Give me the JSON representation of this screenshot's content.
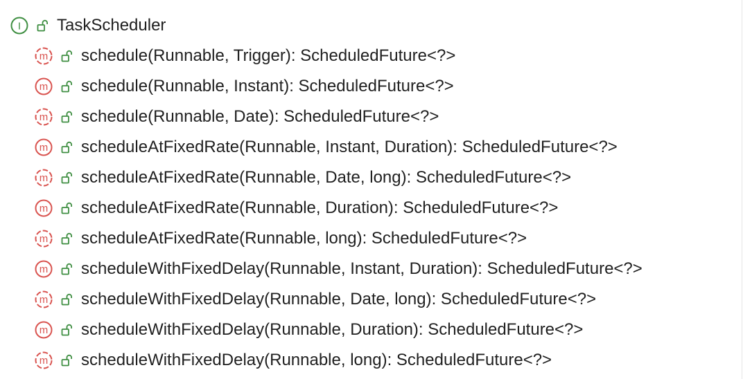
{
  "colors": {
    "interface_badge": "#3e8e41",
    "method_badge": "#d9534f",
    "lock_icon": "#3e8e41",
    "text": "#1f1f1f"
  },
  "root": {
    "icon": "interface-icon",
    "badge_letter": "I",
    "visibility_icon": "unlocked-icon",
    "label": "TaskScheduler"
  },
  "members": [
    {
      "icon": "abstract-method-icon",
      "badge_letter": "m",
      "abstract": true,
      "visibility_icon": "unlocked-icon",
      "label": "schedule(Runnable, Trigger): ScheduledFuture<?>"
    },
    {
      "icon": "method-icon",
      "badge_letter": "m",
      "abstract": false,
      "visibility_icon": "unlocked-icon",
      "label": "schedule(Runnable, Instant): ScheduledFuture<?>"
    },
    {
      "icon": "abstract-method-icon",
      "badge_letter": "m",
      "abstract": true,
      "visibility_icon": "unlocked-icon",
      "label": "schedule(Runnable, Date): ScheduledFuture<?>"
    },
    {
      "icon": "method-icon",
      "badge_letter": "m",
      "abstract": false,
      "visibility_icon": "unlocked-icon",
      "label": "scheduleAtFixedRate(Runnable, Instant, Duration): ScheduledFuture<?>"
    },
    {
      "icon": "abstract-method-icon",
      "badge_letter": "m",
      "abstract": true,
      "visibility_icon": "unlocked-icon",
      "label": "scheduleAtFixedRate(Runnable, Date, long): ScheduledFuture<?>"
    },
    {
      "icon": "method-icon",
      "badge_letter": "m",
      "abstract": false,
      "visibility_icon": "unlocked-icon",
      "label": "scheduleAtFixedRate(Runnable, Duration): ScheduledFuture<?>"
    },
    {
      "icon": "abstract-method-icon",
      "badge_letter": "m",
      "abstract": true,
      "visibility_icon": "unlocked-icon",
      "label": "scheduleAtFixedRate(Runnable, long): ScheduledFuture<?>"
    },
    {
      "icon": "method-icon",
      "badge_letter": "m",
      "abstract": false,
      "visibility_icon": "unlocked-icon",
      "label": "scheduleWithFixedDelay(Runnable, Instant, Duration): ScheduledFuture<?>"
    },
    {
      "icon": "abstract-method-icon",
      "badge_letter": "m",
      "abstract": true,
      "visibility_icon": "unlocked-icon",
      "label": "scheduleWithFixedDelay(Runnable, Date, long): ScheduledFuture<?>"
    },
    {
      "icon": "method-icon",
      "badge_letter": "m",
      "abstract": false,
      "visibility_icon": "unlocked-icon",
      "label": "scheduleWithFixedDelay(Runnable, Duration): ScheduledFuture<?>"
    },
    {
      "icon": "abstract-method-icon",
      "badge_letter": "m",
      "abstract": true,
      "visibility_icon": "unlocked-icon",
      "label": "scheduleWithFixedDelay(Runnable, long): ScheduledFuture<?>"
    }
  ]
}
